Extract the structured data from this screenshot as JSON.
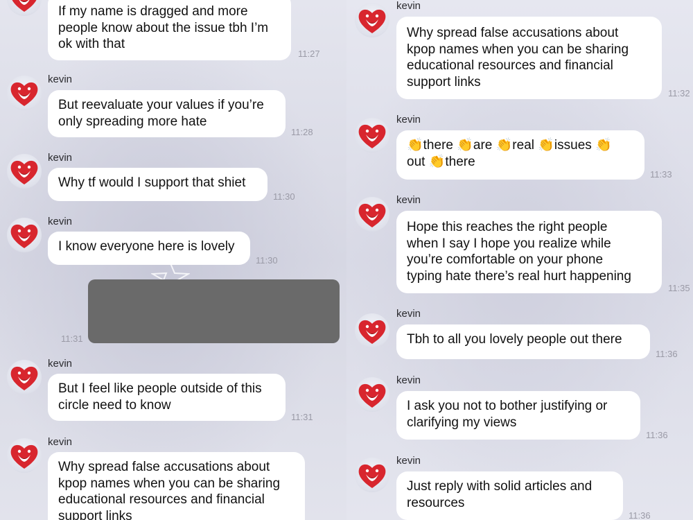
{
  "avatar_icon": "red-heart-character-icon",
  "left": {
    "messages": [
      {
        "sender": "",
        "text": "If my name is dragged and more\npeople know about the issue tbh I’m\nok with that",
        "time": "11:27"
      },
      {
        "sender": "kevin",
        "text": "But reevaluate your values if you’re\nonly spreading more hate",
        "time": "11:28"
      },
      {
        "sender": "kevin",
        "text": "Why tf would I support that shiet",
        "time": "11:30"
      },
      {
        "sender": "kevin",
        "text": "I know everyone here is lovely",
        "time": "11:30"
      },
      {
        "sender": "",
        "text": "",
        "time": "11:31"
      },
      {
        "sender": "kevin",
        "text": "But I feel like people outside of this\ncircle need to know",
        "time": "11:31"
      },
      {
        "sender": "kevin",
        "text": "Why spread false accusations about\nkpop names when you can be sharing\neducational resources and financial\nsupport links",
        "time": ""
      }
    ]
  },
  "right": {
    "messages": [
      {
        "sender": "kevin",
        "text": "Why spread false accusations about\nkpop names when you can be sharing\neducational resources and financial\nsupport links",
        "time": "11:32"
      },
      {
        "sender": "kevin",
        "text": "👏there 👏are 👏real 👏issues 👏\nout 👏there",
        "time": "11:33"
      },
      {
        "sender": "kevin",
        "text": "Hope this reaches the right people\nwhen I say I hope you realize while\nyou’re comfortable on your phone\ntyping hate there’s real hurt happening",
        "time": "11:35"
      },
      {
        "sender": "kevin",
        "text": "Tbh to all you lovely people out there",
        "time": "11:36"
      },
      {
        "sender": "kevin",
        "text": "I ask you not to bother justifying or\nclarifying my views",
        "time": "11:36"
      },
      {
        "sender": "kevin",
        "text": "Just reply with solid articles and\nresources",
        "time": "11:36"
      }
    ]
  }
}
